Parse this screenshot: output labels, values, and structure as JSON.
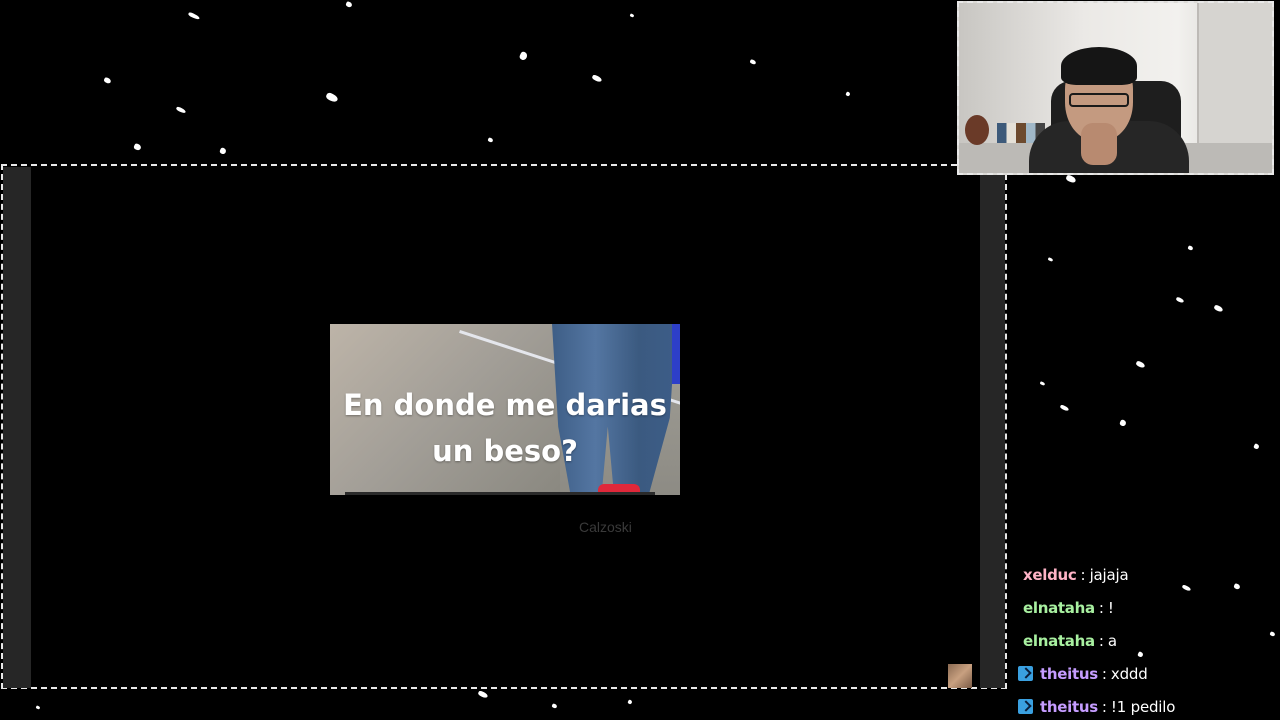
{
  "overlay": {
    "video": {
      "caption_line1": "En donde me darias",
      "caption_line2": "un beso?",
      "author": "Calzoski"
    },
    "webcam": {
      "icon": "webcam-feed"
    }
  },
  "chat": {
    "messages": [
      {
        "user": "xelduc",
        "message": "jajaja",
        "color": "#ffb3c6",
        "badge": false
      },
      {
        "user": "elnataha",
        "message": "!",
        "color": "#a8f0a0",
        "badge": false
      },
      {
        "user": "elnataha",
        "message": "a",
        "color": "#a8f0a0",
        "badge": false
      },
      {
        "user": "theitus",
        "message": "xddd",
        "color": "#c59cff",
        "badge": true
      },
      {
        "user": "theitus",
        "message": "!1 pedilo",
        "color": "#c59cff",
        "badge": true
      }
    ],
    "separator": ":"
  },
  "colors": {
    "background": "#000000",
    "frame_border": "#e8e8e8",
    "badge": "#3aa0e0"
  }
}
